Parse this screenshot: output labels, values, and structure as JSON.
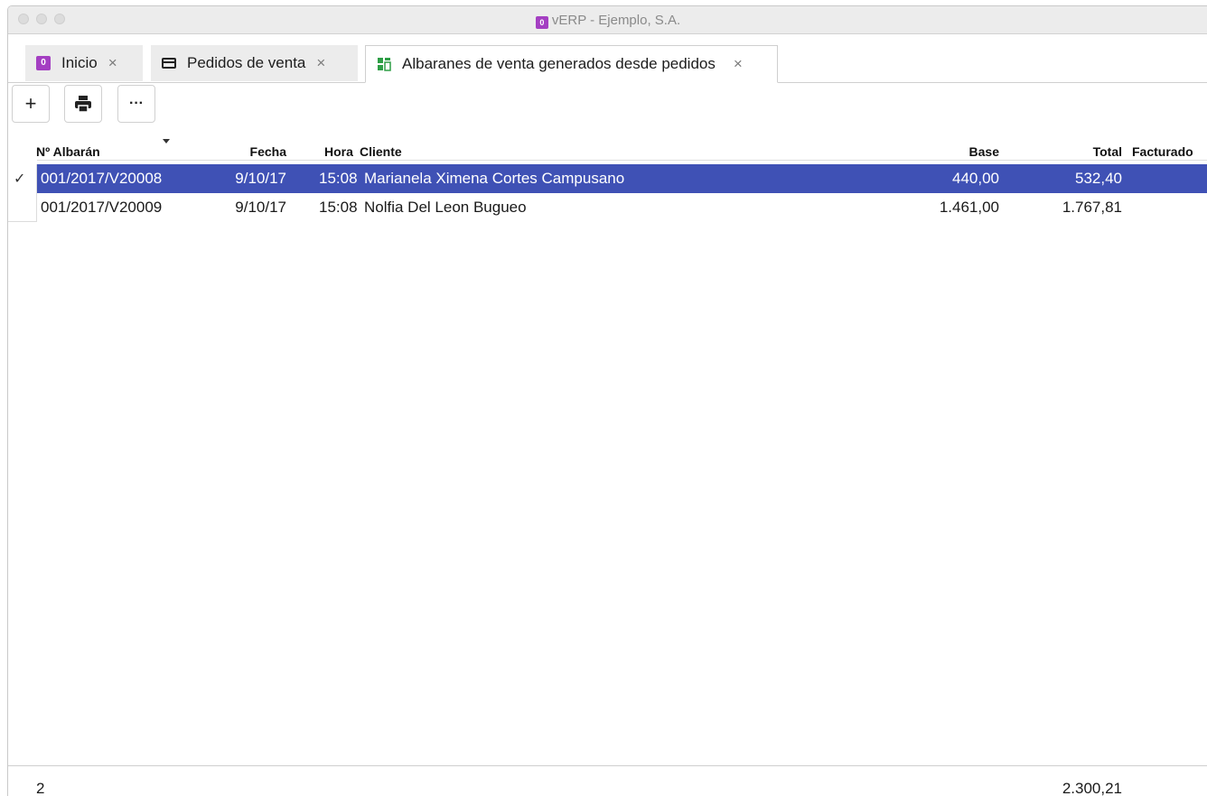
{
  "window": {
    "title": "vERP - Ejemplo, S.A.",
    "logo_text": "0"
  },
  "tabs": [
    {
      "label": "Inicio",
      "icon": "verp-logo-icon",
      "close": "×"
    },
    {
      "label": "Pedidos de venta",
      "icon": "card-icon",
      "close": "×"
    },
    {
      "label": "Albaranes de venta generados desde pedidos",
      "icon": "grid-table-icon",
      "close": "×"
    }
  ],
  "toolbar": {
    "add_label": "+",
    "more_label": "···"
  },
  "table": {
    "columns": {
      "numero": "Nº Albarán",
      "fecha": "Fecha",
      "hora": "Hora",
      "cliente": "Cliente",
      "base": "Base",
      "total": "Total",
      "facturado": "Facturado"
    },
    "rows": [
      {
        "numero": "001/2017/V20008",
        "fecha": "9/10/17",
        "hora": "15:08",
        "cliente": "Marianela Ximena Cortes Campusano",
        "base": "440,00",
        "total": "532,40",
        "facturado": "",
        "selected": true
      },
      {
        "numero": "001/2017/V20009",
        "fecha": "9/10/17",
        "hora": "15:08",
        "cliente": "Nolfia Del Leon Bugueo",
        "base": "1.461,00",
        "total": "1.767,81",
        "facturado": "",
        "selected": false
      }
    ],
    "selected_mark": "✓"
  },
  "footer": {
    "count": "2",
    "total_sum": "2.300,21"
  },
  "colors": {
    "selection": "#3f51b5",
    "brand": "#a43fc2"
  }
}
